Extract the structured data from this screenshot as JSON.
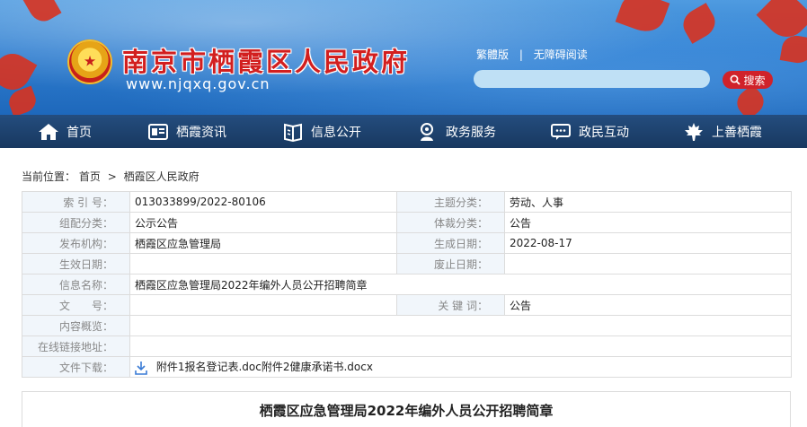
{
  "header": {
    "site_title": "南京市栖霞区人民政府",
    "site_url": "www.njqxq.gov.cn",
    "links": {
      "traditional": "繁體版",
      "accessible": "无障碍阅读"
    },
    "search": {
      "placeholder": "",
      "button_label": "搜索"
    }
  },
  "nav": {
    "items": [
      {
        "label": "首页",
        "icon": "home-icon"
      },
      {
        "label": "栖霞资讯",
        "icon": "news-icon"
      },
      {
        "label": "信息公开",
        "icon": "document-icon"
      },
      {
        "label": "政务服务",
        "icon": "service-icon"
      },
      {
        "label": "政民互动",
        "icon": "chat-icon"
      },
      {
        "label": "上善栖霞",
        "icon": "maple-leaf-icon"
      }
    ]
  },
  "breadcrumb": {
    "prefix": "当前位置：",
    "items": [
      "首页",
      "栖霞区人民政府"
    ],
    "separator": ">"
  },
  "info": {
    "index_label": "索 引 号：",
    "index_value": "013033899/2022-80106",
    "topic_label": "主题分类：",
    "topic_value": "劳动、人事",
    "group_label": "组配分类：",
    "group_value": "公示公告",
    "genre_label": "体裁分类：",
    "genre_value": "公告",
    "publisher_label": "发布机构：",
    "publisher_value": "栖霞区应急管理局",
    "created_label": "生成日期：",
    "created_value": "2022-08-17",
    "effective_label": "生效日期：",
    "effective_value": "",
    "abolished_label": "废止日期：",
    "abolished_value": "",
    "name_label": "信息名称：",
    "name_value": "栖霞区应急管理局2022年编外人员公开招聘简章",
    "docno_label": "文　　号：",
    "docno_value": "",
    "keyword_label": "关 键 词：",
    "keyword_value": "公告",
    "summary_label": "内容概览：",
    "summary_value": "",
    "link_label": "在线链接地址：",
    "link_value": "",
    "download_label": "文件下载：",
    "download_value": "附件1报名登记表.doc附件2健康承诺书.docx"
  },
  "article": {
    "title": "栖霞区应急管理局2022年编外人员公开招聘简章"
  },
  "colors": {
    "nav_bg": "#1a3f6b",
    "title_red": "#d21f1f",
    "search_btn": "#d0222a",
    "label_bg": "#f1f6fb"
  }
}
